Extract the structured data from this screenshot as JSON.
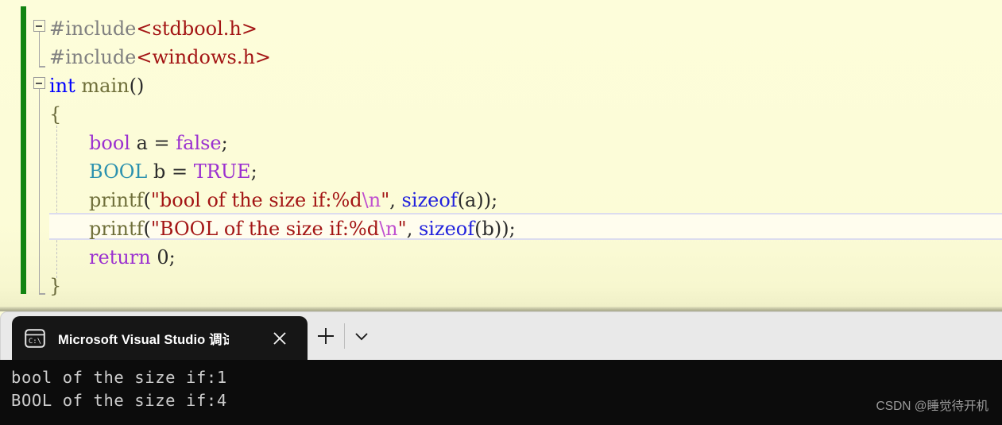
{
  "editor": {
    "name": "visual-studio-code-editor",
    "background_color": "#FCFCD8",
    "change_bar_color": "#128412",
    "current_line_index": 7,
    "lines": [
      {
        "n": 1,
        "indent": 0,
        "fold": "open",
        "tokens": [
          {
            "text": "#include",
            "cls": "t-pre"
          },
          {
            "text": "<stdbool.h>",
            "cls": "t-inc"
          }
        ]
      },
      {
        "n": 2,
        "indent": 0,
        "fold": "none",
        "tokens": [
          {
            "text": "#include",
            "cls": "t-pre"
          },
          {
            "text": "<windows.h>",
            "cls": "t-inc"
          }
        ]
      },
      {
        "n": 3,
        "indent": 0,
        "fold": "open",
        "tokens": [
          {
            "text": "int",
            "cls": "t-kw"
          },
          {
            "text": " ",
            "cls": "t-plain"
          },
          {
            "text": "main",
            "cls": "t-func"
          },
          {
            "text": "()",
            "cls": "t-punct"
          }
        ]
      },
      {
        "n": 4,
        "indent": 0,
        "fold": "none",
        "tokens": [
          {
            "text": "{",
            "cls": "t-brace"
          }
        ]
      },
      {
        "n": 5,
        "indent": 1,
        "fold": "none",
        "tokens": [
          {
            "text": "bool",
            "cls": "t-type"
          },
          {
            "text": " a = ",
            "cls": "t-plain"
          },
          {
            "text": "false",
            "cls": "t-lit"
          },
          {
            "text": ";",
            "cls": "t-punct"
          }
        ]
      },
      {
        "n": 6,
        "indent": 1,
        "fold": "none",
        "tokens": [
          {
            "text": "BOOL",
            "cls": "t-macro"
          },
          {
            "text": " b = ",
            "cls": "t-plain"
          },
          {
            "text": "TRUE",
            "cls": "t-lit"
          },
          {
            "text": ";",
            "cls": "t-punct"
          }
        ]
      },
      {
        "n": 7,
        "indent": 1,
        "fold": "none",
        "tokens": [
          {
            "text": "printf",
            "cls": "t-func"
          },
          {
            "text": "(",
            "cls": "t-punct"
          },
          {
            "text": "\"bool of the size if:%d",
            "cls": "t-str"
          },
          {
            "text": "\\n",
            "cls": "t-esc"
          },
          {
            "text": "\"",
            "cls": "t-str"
          },
          {
            "text": ", ",
            "cls": "t-punct"
          },
          {
            "text": "sizeof",
            "cls": "t-fn2"
          },
          {
            "text": "(a));",
            "cls": "t-punct"
          }
        ]
      },
      {
        "n": 8,
        "indent": 1,
        "fold": "none",
        "tokens": [
          {
            "text": "printf",
            "cls": "t-func"
          },
          {
            "text": "(",
            "cls": "t-punct"
          },
          {
            "text": "\"BOOL of the size if:%d",
            "cls": "t-str"
          },
          {
            "text": "\\n",
            "cls": "t-esc"
          },
          {
            "text": "\"",
            "cls": "t-str"
          },
          {
            "text": ", ",
            "cls": "t-punct"
          },
          {
            "text": "sizeof",
            "cls": "t-fn2"
          },
          {
            "text": "(b));",
            "cls": "t-punct"
          }
        ]
      },
      {
        "n": 9,
        "indent": 1,
        "fold": "none",
        "tokens": [
          {
            "text": "return",
            "cls": "t-type"
          },
          {
            "text": " ",
            "cls": "t-plain"
          },
          {
            "text": "0",
            "cls": "t-num"
          },
          {
            "text": ";",
            "cls": "t-punct"
          }
        ]
      },
      {
        "n": 10,
        "indent": 0,
        "fold": "none",
        "tokens": [
          {
            "text": "}",
            "cls": "t-brace"
          }
        ]
      }
    ]
  },
  "terminal": {
    "tab": {
      "icon": "console-cmd-icon",
      "title": "Microsoft Visual Studio 调试控",
      "close_glyph": "✕"
    },
    "new_tab_glyph": "+",
    "dropdown_glyph": "⌄",
    "background_color": "#0C0C0C",
    "text_color": "#CCCCCC",
    "output_lines": [
      "bool of the size if:1",
      "BOOL of the size if:4"
    ]
  },
  "watermark": {
    "text": "CSDN @睡觉待开机"
  }
}
